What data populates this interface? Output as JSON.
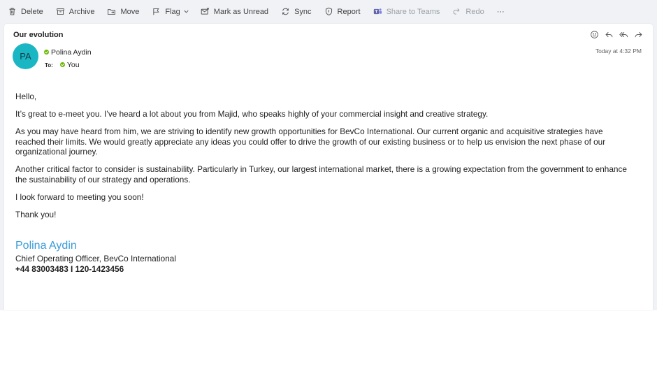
{
  "toolbar": {
    "delete": "Delete",
    "archive": "Archive",
    "move": "Move",
    "flag": "Flag",
    "mark_unread": "Mark as Unread",
    "sync": "Sync",
    "report": "Report",
    "share_teams": "Share to Teams",
    "redo": "Redo",
    "more": "···"
  },
  "email": {
    "subject": "Our evolution",
    "avatar_initials": "PA",
    "sender_name": "Polina Aydin",
    "to_label": "To:",
    "to_name": "You",
    "date": "Today at 4:32 PM",
    "body": [
      "Hello,",
      "It’s great to e-meet you. I’ve heard a lot about you from Majid, who speaks highly of your commercial insight and creative strategy.",
      "As you may have heard from him, we are striving to identify new growth opportunities for BevCo International. Our current organic and acquisitive strategies have reached their limits. We would greatly appreciate any ideas you could offer to drive the growth of our existing business or to help us envision the next phase of our organizational journey.",
      "Another critical factor to consider is sustainability. Particularly in Turkey, our largest international market, there is a growing expectation from the government to enhance the sustainability of our strategy and operations.",
      "I look forward to meeting you soon!",
      "Thank you!"
    ],
    "signature": {
      "name": "Polina Aydin",
      "title": "Chief Operating Officer, BevCo International",
      "phone": "+44 83003483 I 120-1423456"
    }
  },
  "colors": {
    "avatar": "#1bb6c4",
    "signature_name": "#3a9bd8",
    "presence": "#6bb700",
    "teams": "#6264a7"
  }
}
